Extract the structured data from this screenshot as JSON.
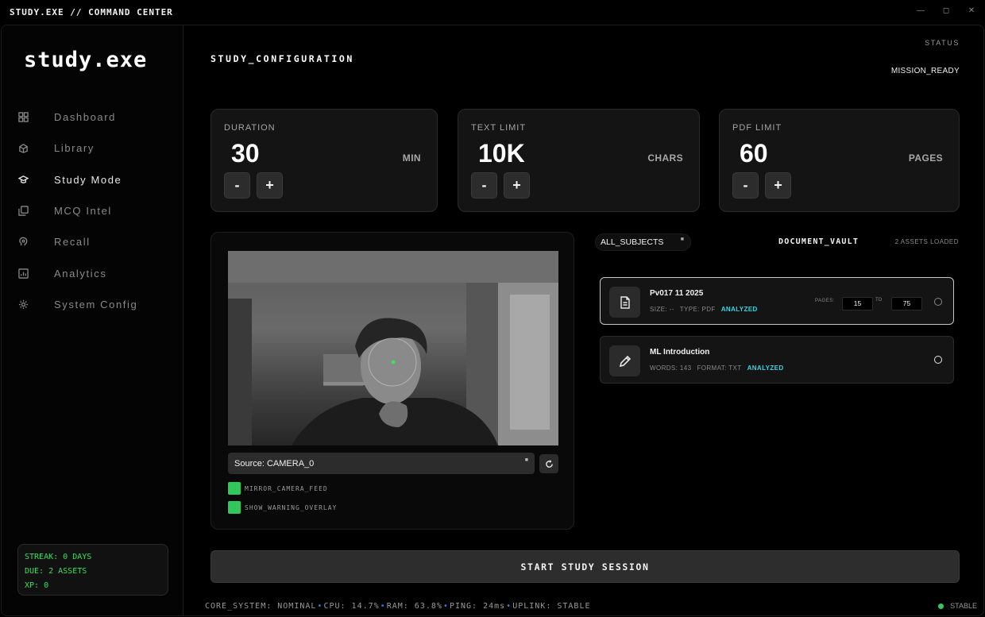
{
  "window": {
    "title": "STUDY.EXE // COMMAND CENTER",
    "controls": [
      "—",
      "◻",
      "✕"
    ]
  },
  "sidebar": {
    "brand": "study.exe",
    "items": [
      {
        "label": "Dashboard",
        "icon": "grid-icon"
      },
      {
        "label": "Library",
        "icon": "box-icon"
      },
      {
        "label": "Study Mode",
        "icon": "graduation-cap-icon",
        "active": true
      },
      {
        "label": "MCQ Intel",
        "icon": "stack-icon"
      },
      {
        "label": "Recall",
        "icon": "brain-icon"
      },
      {
        "label": "Analytics",
        "icon": "chart-icon"
      },
      {
        "label": "System Config",
        "icon": "gear-icon"
      }
    ],
    "streak": {
      "streak": "STREAK: 0 DAYS",
      "due": "DUE: 2 ASSETS",
      "xp": "XP: 0"
    }
  },
  "header": {
    "title": "STUDY_CONFIGURATION",
    "status_label": "STATUS",
    "status_value": "MISSION_READY"
  },
  "cards": [
    {
      "label": "DURATION",
      "value": "30",
      "unit": "MIN",
      "minus": "-",
      "plus": "+"
    },
    {
      "label": "TEXT LIMIT",
      "value": "10K",
      "unit": "CHARS",
      "minus": "-",
      "plus": "+"
    },
    {
      "label": "PDF LIMIT",
      "value": "60",
      "unit": "PAGES",
      "minus": "-",
      "plus": "+"
    }
  ],
  "camera": {
    "source": "Source: CAMERA_0",
    "options": [
      {
        "label": "MIRROR_CAMERA_FEED",
        "checked": true
      },
      {
        "label": "SHOW_WARNING_OVERLAY",
        "checked": true
      }
    ]
  },
  "vault": {
    "filter": "ALL_SUBJECTS",
    "title": "DOCUMENT_VAULT",
    "count": "2 ASSETS LOADED",
    "docs": [
      {
        "name": "Pv017 11 2025",
        "meta1": "SIZE: --",
        "meta2": "TYPE: PDF",
        "status": "ANALYZED",
        "pages_label": "PAGES:",
        "from": "15",
        "to_label": "TO",
        "to": "75",
        "icon": "document-icon",
        "selected": true
      },
      {
        "name": "ML Introduction",
        "meta1": "WORDS: 143",
        "meta2": "FORMAT: TXT",
        "status": "ANALYZED",
        "icon": "pencil-icon",
        "selected": false
      }
    ]
  },
  "actions": {
    "start": "START STUDY SESSION"
  },
  "footer": {
    "core": "CORE_SYSTEM: NOMINAL",
    "cpu": "CPU: 14.7%",
    "ram": "RAM: 63.8%",
    "ping": "PING: 24ms",
    "uplink": "UPLINK: STABLE",
    "sep": "•",
    "stable": "STABLE"
  },
  "colors": {
    "accent_green": "#34c759",
    "accent_cyan": "#33d6e6",
    "separator_blue": "#2f7fd8"
  }
}
